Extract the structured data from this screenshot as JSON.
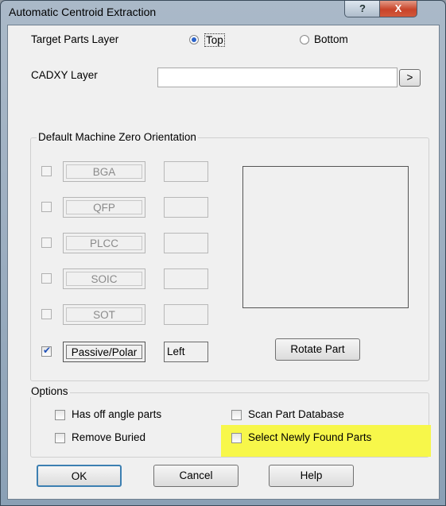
{
  "window": {
    "title": "Automatic Centroid Extraction",
    "help_glyph": "?",
    "close_glyph": "X"
  },
  "target_parts": {
    "label": "Target Parts Layer",
    "options": [
      {
        "label": "Top",
        "selected": true
      },
      {
        "label": "Bottom",
        "selected": false
      }
    ]
  },
  "cadxy": {
    "label": "CADXY Layer",
    "value": "",
    "browse_label": ">"
  },
  "machine_zero": {
    "legend": "Default Machine Zero Orientation",
    "rows": [
      {
        "label": "BGA",
        "checked": false,
        "enabled": false,
        "value": ""
      },
      {
        "label": "QFP",
        "checked": false,
        "enabled": false,
        "value": ""
      },
      {
        "label": "PLCC",
        "checked": false,
        "enabled": false,
        "value": ""
      },
      {
        "label": "SOIC",
        "checked": false,
        "enabled": false,
        "value": ""
      },
      {
        "label": "SOT",
        "checked": false,
        "enabled": false,
        "value": ""
      },
      {
        "label": "Passive/Polar",
        "checked": true,
        "enabled": true,
        "value": "Left"
      }
    ],
    "rotate_label": "Rotate Part"
  },
  "options": {
    "legend": "Options",
    "has_off_angle": {
      "label": "Has off angle parts",
      "checked": false
    },
    "scan_db": {
      "label": "Scan Part Database",
      "checked": false
    },
    "remove_buried": {
      "label": "Remove Buried",
      "checked": false
    },
    "select_new": {
      "label": "Select Newly Found Parts",
      "checked": false,
      "highlight_color": "#f7f74a"
    }
  },
  "buttons": {
    "ok": "OK",
    "cancel": "Cancel",
    "help": "Help"
  }
}
